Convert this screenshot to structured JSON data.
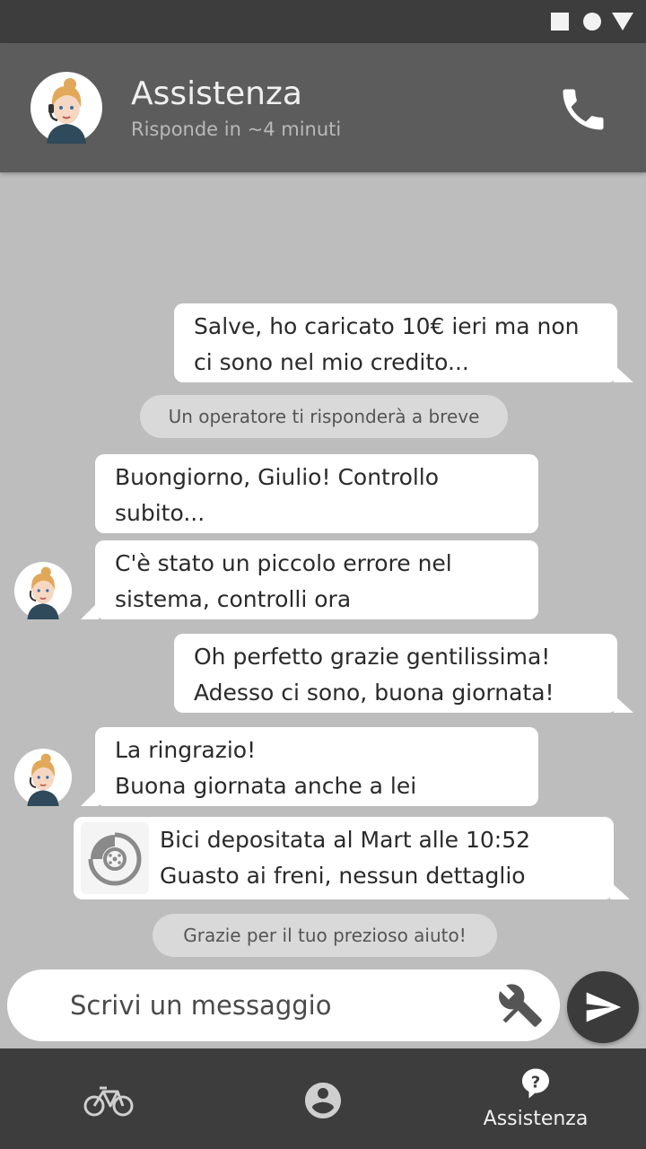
{
  "header": {
    "title": "Assistenza",
    "subtitle": "Risponde in ~4 minuti"
  },
  "messages": {
    "m1": {
      "line1": "Salve, ho caricato 10€ ieri ma non",
      "line2": "ci sono nel mio credito..."
    },
    "notice1": "Un operatore ti risponderà a breve",
    "m2": {
      "line1": "Buongiorno, Giulio! Controllo",
      "line2": "subito..."
    },
    "m3": {
      "line1": "C'è stato un piccolo errore nel",
      "line2": "sistema, controlli ora"
    },
    "m4": {
      "line1": "Oh perfetto grazie gentilissima!",
      "line2": "Adesso ci sono, buona giornata!"
    },
    "m5": {
      "line1": "La ringrazio!",
      "line2": "Buona giornata anche a lei"
    },
    "card": {
      "line1": "Bici depositata al Mart alle 10:52",
      "line2": "Guasto ai freni, nessun dettaglio"
    },
    "notice2": "Grazie per il tuo prezioso aiuto!"
  },
  "composer": {
    "placeholder": "Scrivi un messaggio",
    "tools_icon": "tools-icon",
    "send_icon": "send-icon"
  },
  "nav": {
    "items": [
      {
        "icon": "bike-icon",
        "label": ""
      },
      {
        "icon": "account-icon",
        "label": ""
      },
      {
        "icon": "help-icon",
        "label": "Assistenza"
      }
    ]
  },
  "colors": {
    "statusbar": "#3d3d3d",
    "header": "#5c5c5c",
    "chat_bg": "#bdbdbd",
    "bubble": "#ffffff",
    "notice": "#d9d9d9"
  }
}
